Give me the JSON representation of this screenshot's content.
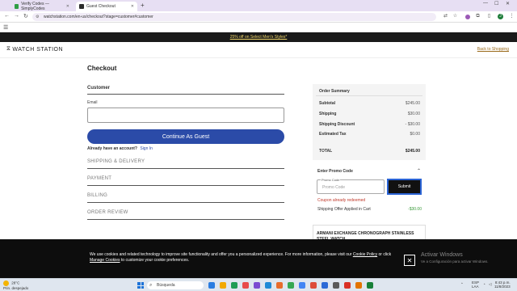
{
  "browser": {
    "tabs": [
      {
        "title": "Verify Codes — SimplyCodes",
        "favicon_color": "#2f9e44"
      },
      {
        "title": "Guest Checkout",
        "favicon_color": "#2b2b2b"
      }
    ],
    "new_tab_label": "+",
    "url": "watchstation.com/en-us/checkout?stage=customer#customer",
    "profile_initial": "J"
  },
  "site": {
    "promo_bar": "25% off on Select Men's Styles*",
    "logo_text": "WATCH STATION",
    "back_link": "Back to Shopping"
  },
  "checkout": {
    "title": "Checkout",
    "customer_heading": "Customer",
    "email_label": "Email",
    "email_value": "",
    "continue_button": "Continue As Guest",
    "account_question": "Already have an account?",
    "sign_in_link": "Sign In",
    "steps": [
      "SHIPPING & DELIVERY",
      "PAYMENT",
      "BILLING",
      "ORDER REVIEW"
    ]
  },
  "summary": {
    "heading": "Order Summary",
    "rows": [
      {
        "label": "Subtotal",
        "value": "$245.00"
      },
      {
        "label": "Shipping",
        "value": "$30.00"
      },
      {
        "label": "Shipping Discount",
        "value": "- $30.00"
      },
      {
        "label": "Estimated Tax",
        "value": "$0.00"
      }
    ],
    "total_label": "TOTAL",
    "total_value": "$245.00"
  },
  "promo": {
    "heading": "Enter Promo Code",
    "floating_label": "Promo Code",
    "placeholder": "Promo Code",
    "submit_label": "Submit",
    "error_text": "Coupon already redeemed",
    "offer_label": "Shipping Offer Applied in Cart",
    "offer_value": "-$30.00"
  },
  "product": {
    "name": "ARMANI EXCHANGE CHRONOGRAPH STAINLESS STEEL WATCH"
  },
  "cookie": {
    "text_before": "We use cookies and related technology to improve site functionality and offer you a personalized experience. For more information, please visit our",
    "policy_link": "Cookie Policy",
    "text_middle": "or click",
    "manage_link": "Manage Cookies",
    "text_after": "to customize your cookie preferences.",
    "close_label": "✕"
  },
  "windows": {
    "activate_title": "Activar Windows",
    "activate_sub": "Ve a Configuración para activar Windows."
  },
  "taskbar": {
    "temperature": "28°C",
    "weather_desc": "Prin. despejado",
    "search_placeholder": "Búsqueda",
    "lang_line1": "ESP",
    "lang_line2": "LAA",
    "time": "8:43 p.m.",
    "date": "11/8/2023",
    "app_colors": [
      "#2a7de1",
      "#f2a900",
      "#1f9d55",
      "#e84a4a",
      "#7b4bd1",
      "#1f8ad6",
      "#e86c2c",
      "#36a852",
      "#4285f4",
      "#dd4b39",
      "#2c6ad6",
      "#5a5a5a",
      "#d93025",
      "#e37400",
      "#188038"
    ]
  }
}
